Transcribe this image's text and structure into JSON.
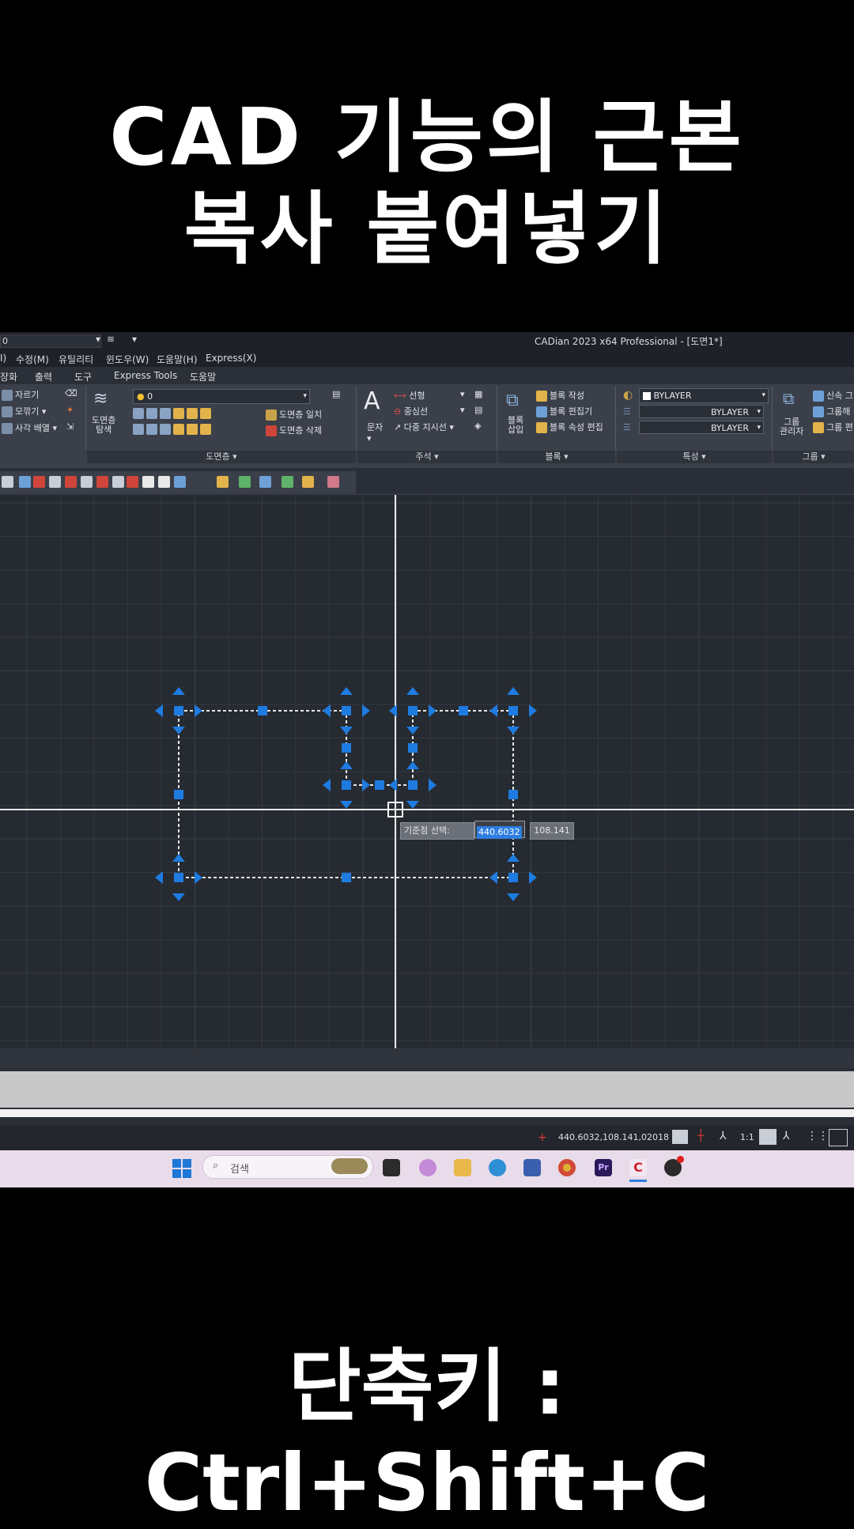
{
  "overlay": {
    "title_line1": "CAD 기능의 근본",
    "title_line2": "복사 붙여넣기",
    "shortcut": "단축키 : Ctrl+Shift+C"
  },
  "app": {
    "title": "CADian 2023 x64 Professional - [도면1*]",
    "layer_combo": "0"
  },
  "menu": [
    "I)",
    "수정(M)",
    "유틸리티",
    "윈도우(W)",
    "도움말(H)",
    "Express(X)"
  ],
  "tabs": [
    "장화",
    "출력",
    "도구",
    "Express Tools",
    "도움말"
  ],
  "ribbon": {
    "modify": {
      "items": [
        "자르기",
        "모깎기",
        "사각 배열"
      ]
    },
    "layer": {
      "big_button": "도면층\n탐색",
      "combo": "0",
      "items": [
        "도면층 일치",
        "도면층 삭제"
      ],
      "title": "도면층"
    },
    "annotation": {
      "big_button": "문자",
      "items": [
        "선형",
        "중심선",
        "다중 지시선"
      ],
      "title": "주석"
    },
    "block": {
      "big_button": "블록\n삽입",
      "items": [
        "블록 작성",
        "블록 편집기",
        "블록 속성 편집"
      ],
      "title": "블록"
    },
    "properties": {
      "combo_color": "BYLAYER",
      "combo_linetype": "BYLAYER",
      "combo_lineweight": "BYLAYER",
      "title": "특성"
    },
    "group": {
      "big_button": "그룹\n관리자",
      "items": [
        "신속 그",
        "그룹해",
        "그룹 편"
      ],
      "title": "그룹"
    }
  },
  "drawing": {
    "prompt_label": "기준점 선택:",
    "x_value": "440.6032",
    "y_value": "108.141"
  },
  "statusbar": {
    "coordinates": "440.6032,108.141,0",
    "year": "2018",
    "scale": "1:1"
  },
  "taskbar": {
    "search_placeholder": "검색"
  },
  "colors": {
    "grip": "#1e7be0",
    "canvas": "#262a31",
    "grid": "#323843"
  }
}
